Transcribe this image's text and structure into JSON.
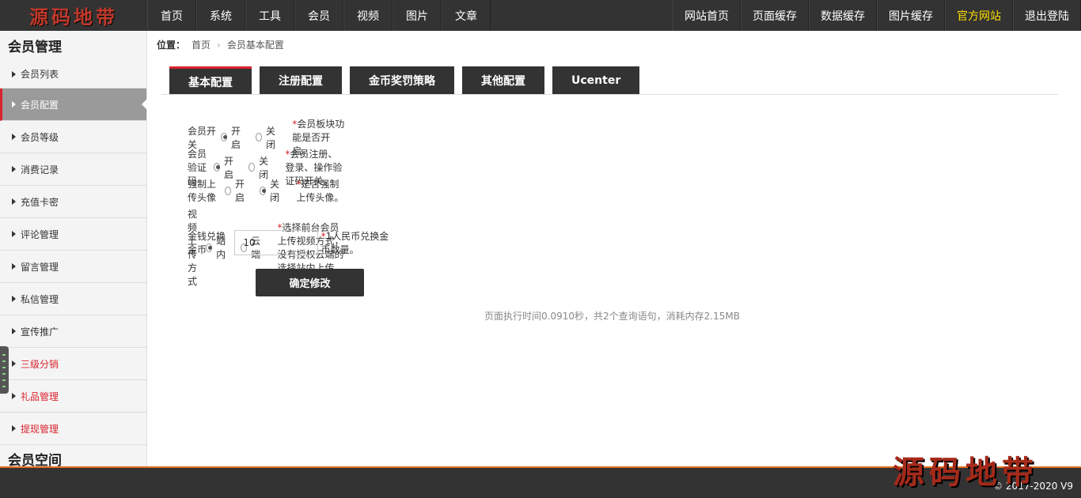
{
  "logo": "源码地带",
  "nav_left": [
    "首页",
    "系统",
    "工具",
    "会员",
    "视频",
    "图片",
    "文章"
  ],
  "nav_right": [
    "网站首页",
    "页面缓存",
    "数据缓存",
    "图片缓存",
    "官方网站",
    "退出登陆"
  ],
  "sidebar": {
    "title": "会员管理",
    "items": [
      {
        "label": "会员列表"
      },
      {
        "label": "会员配置"
      },
      {
        "label": "会员等级"
      },
      {
        "label": "消费记录"
      },
      {
        "label": "充值卡密"
      },
      {
        "label": "评论管理"
      },
      {
        "label": "留言管理"
      },
      {
        "label": "私信管理"
      },
      {
        "label": "宣传推广"
      },
      {
        "label": "三级分销"
      },
      {
        "label": "礼品管理"
      },
      {
        "label": "提现管理"
      }
    ],
    "title2": "会员空间"
  },
  "breadcrumb": {
    "prefix": "位置：",
    "home": "首页",
    "sep": "›",
    "current": "会员基本配置"
  },
  "tabs": [
    "基本配置",
    "注册配置",
    "金币奖罚策略",
    "其他配置",
    "Ucenter"
  ],
  "form": {
    "rows": [
      {
        "label": "会员开关",
        "opt1": "开启",
        "opt2": "关闭",
        "selected": "opt1",
        "star": "*",
        "hint": "会员板块功能是否开启。"
      },
      {
        "label": "会员验证码",
        "opt1": "开启",
        "opt2": "关闭",
        "selected": "opt1",
        "star": "*",
        "hint": "会员注册、登录、操作验证码开关。"
      },
      {
        "label": "强制上传头像",
        "opt1": "开启",
        "opt2": "关闭",
        "selected": "opt2",
        "star": "*",
        "hint": "是否强制上传头像。"
      },
      {
        "label": "视频上传方式",
        "opt1": "站内",
        "opt2": "云端",
        "selected": "opt1",
        "star": "*",
        "hint": "选择前台会员上传视频方式，没有授权云端的选择站内上传"
      }
    ],
    "money": {
      "label": "金钱兑换金币",
      "value": "10",
      "star": "*",
      "hint": "1人民币兑换金币数量。"
    },
    "submit": "确定修改"
  },
  "runtime_note": "页面执行时间0.0910秒，共2个查询语句，消耗内存2.15MB",
  "copyright": "© 2017-2020 V9",
  "watermark": "源码地带"
}
